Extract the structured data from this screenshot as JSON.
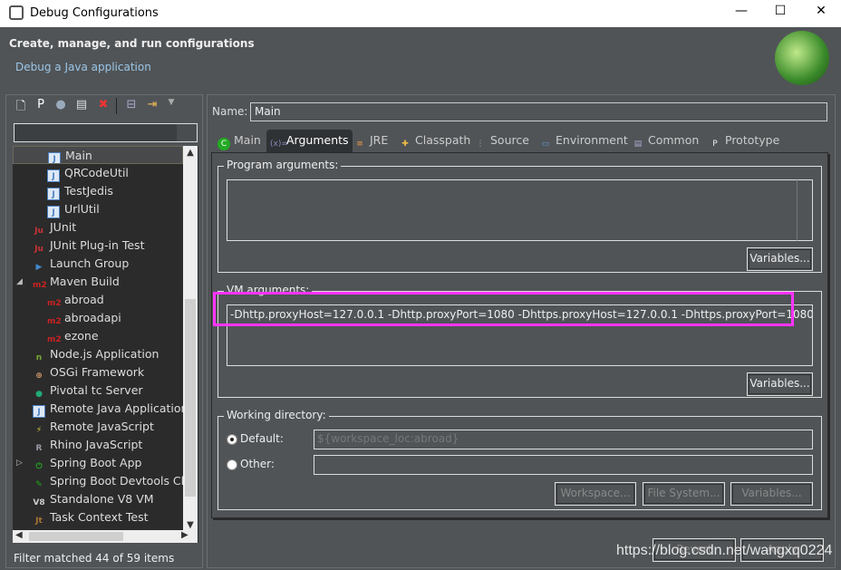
{
  "window": {
    "title": "Debug Configurations",
    "minimize": "—",
    "maximize": "☐",
    "close": "✕"
  },
  "header": {
    "title": "Create, manage, and run configurations",
    "subtitle": "Debug a Java application"
  },
  "toolbar": {
    "icons": [
      "new-config-icon",
      "new-prototype-icon",
      "export-icon",
      "duplicate-icon",
      "delete-icon",
      "collapse-all-icon",
      "filter-icon",
      "dropdown-icon"
    ]
  },
  "filter": {
    "value": ""
  },
  "tree": [
    {
      "label": "Main",
      "icon": "J",
      "indent": 2,
      "selected": true
    },
    {
      "label": "QRCodeUtil",
      "icon": "J",
      "indent": 2
    },
    {
      "label": "TestJedis",
      "icon": "J",
      "indent": 2
    },
    {
      "label": "UrlUtil",
      "icon": "J",
      "indent": 2
    },
    {
      "label": "JUnit",
      "icon": "Ju",
      "indent": 1
    },
    {
      "label": "JUnit Plug-in Test",
      "icon": "Ju",
      "indent": 1
    },
    {
      "label": "Launch Group",
      "icon": "▶",
      "indent": 1
    },
    {
      "label": "Maven Build",
      "icon": "m2",
      "indent": 1,
      "expanded": true
    },
    {
      "label": "abroad",
      "icon": "m2",
      "indent": 2
    },
    {
      "label": "abroadapi",
      "icon": "m2",
      "indent": 2
    },
    {
      "label": "ezone",
      "icon": "m2",
      "indent": 2
    },
    {
      "label": "Node.js Application",
      "icon": "n",
      "indent": 1
    },
    {
      "label": "OSGi Framework",
      "icon": "⊕",
      "indent": 1
    },
    {
      "label": "Pivotal tc Server",
      "icon": "●",
      "indent": 1
    },
    {
      "label": "Remote Java Application",
      "icon": "J",
      "indent": 1
    },
    {
      "label": "Remote JavaScript",
      "icon": "⚡",
      "indent": 1
    },
    {
      "label": "Rhino JavaScript",
      "icon": "R",
      "indent": 1
    },
    {
      "label": "Spring Boot App",
      "icon": "⏻",
      "indent": 1,
      "collapsed": true
    },
    {
      "label": "Spring Boot Devtools Client",
      "icon": "✎",
      "indent": 1
    },
    {
      "label": "Standalone V8 VM",
      "icon": "V8",
      "indent": 1
    },
    {
      "label": "Task Context Test",
      "icon": "Jt",
      "indent": 1
    }
  ],
  "status": "Filter matched 44 of 59 items",
  "name": {
    "label": "Name:",
    "value": "Main"
  },
  "tabs": [
    {
      "label": "Main",
      "icon": "C"
    },
    {
      "label": "Arguments",
      "icon": "(x)=",
      "active": true
    },
    {
      "label": "JRE",
      "icon": "≡"
    },
    {
      "label": "Classpath",
      "icon": "✚"
    },
    {
      "label": "Source",
      "icon": "⋮"
    },
    {
      "label": "Environment",
      "icon": "▭"
    },
    {
      "label": "Common",
      "icon": "▤"
    },
    {
      "label": "Prototype",
      "icon": "P"
    }
  ],
  "program_args": {
    "label": "Program arguments:",
    "value": "",
    "variables": "Variables..."
  },
  "vm_args": {
    "label": "VM arguments:",
    "value": "-Dhttp.proxyHost=127.0.0.1 -Dhttp.proxyPort=1080 -Dhttps.proxyHost=127.0.0.1 -Dhttps.proxyPort=1080",
    "variables": "Variables..."
  },
  "working_dir": {
    "label": "Working directory:",
    "default_label": "Default:",
    "default_value": "${workspace_loc:abroad}",
    "other_label": "Other:",
    "other_value": "",
    "workspace": "Workspace...",
    "file_system": "File System...",
    "variables": "Variables..."
  },
  "footer": {
    "revert": "Revert",
    "apply": "Apply"
  },
  "watermark": "https://blog.csdn.net/wangxq0224",
  "colors": {
    "background": "#505457",
    "highlight": "#ff33ff",
    "list_bg": "#2b2b2b"
  }
}
